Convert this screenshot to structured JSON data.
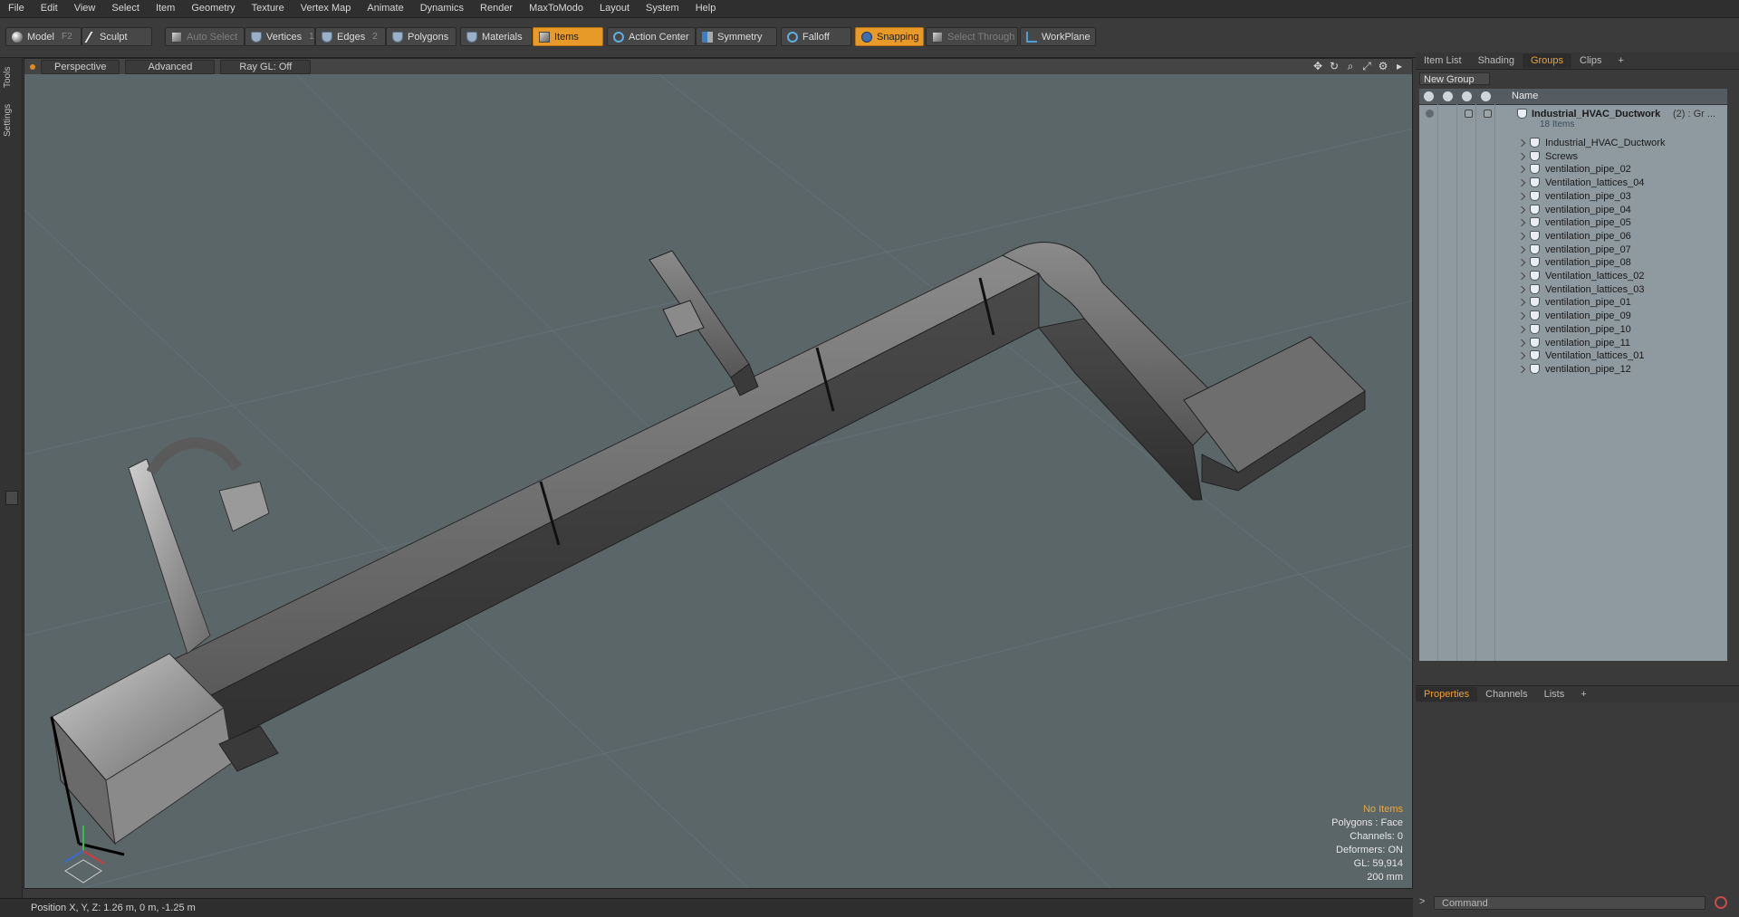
{
  "menubar": [
    "File",
    "Edit",
    "View",
    "Select",
    "Item",
    "Geometry",
    "Texture",
    "Vertex Map",
    "Animate",
    "Dynamics",
    "Render",
    "MaxToModo",
    "Layout",
    "System",
    "Help"
  ],
  "toolbar": {
    "model": "Model",
    "model_key": "F2",
    "sculpt": "Sculpt",
    "auto_select": "Auto Select",
    "vertices": "Vertices",
    "vertices_key": "1",
    "edges": "Edges",
    "edges_key": "2",
    "polygons": "Polygons",
    "materials": "Materials",
    "items": "Items",
    "action_center": "Action Center",
    "symmetry": "Symmetry",
    "falloff": "Falloff",
    "snapping": "Snapping",
    "select_through": "Select Through",
    "workplane": "WorkPlane"
  },
  "left_strip": {
    "tools": "Tools",
    "settings": "Settings"
  },
  "viewport": {
    "perspective": "Perspective",
    "advanced": "Advanced",
    "raygl": "Ray GL: Off",
    "stats": {
      "no_items": "No Items",
      "polygons": "Polygons : Face",
      "channels": "Channels: 0",
      "deformers": "Deformers: ON",
      "gl": "GL: 59,914",
      "scale": "200 mm"
    }
  },
  "status": {
    "position": "Position X, Y, Z:   1.26 m, 0 m, -1.25 m"
  },
  "right_panel": {
    "tabs": [
      "Item List",
      "Shading",
      "Groups",
      "Clips",
      "+"
    ],
    "new_group": "New Group",
    "name_col": "Name",
    "group_name": "Industrial_HVAC_Ductwork",
    "group_suffix": "(2) : Gr ...",
    "group_count": "18 Items",
    "items": [
      "Industrial_HVAC_Ductwork",
      "Screws",
      "ventilation_pipe_02",
      "Ventilation_lattices_04",
      "ventilation_pipe_03",
      "ventilation_pipe_04",
      "ventilation_pipe_05",
      "ventilation_pipe_06",
      "ventilation_pipe_07",
      "ventilation_pipe_08",
      "Ventilation_lattices_02",
      "Ventilation_lattices_03",
      "ventilation_pipe_01",
      "ventilation_pipe_09",
      "ventilation_pipe_10",
      "ventilation_pipe_11",
      "Ventilation_lattices_01",
      "ventilation_pipe_12"
    ],
    "bottom_tabs": [
      "Properties",
      "Channels",
      "Lists",
      "+"
    ],
    "command_placeholder": "Command",
    "prompt": ">"
  }
}
